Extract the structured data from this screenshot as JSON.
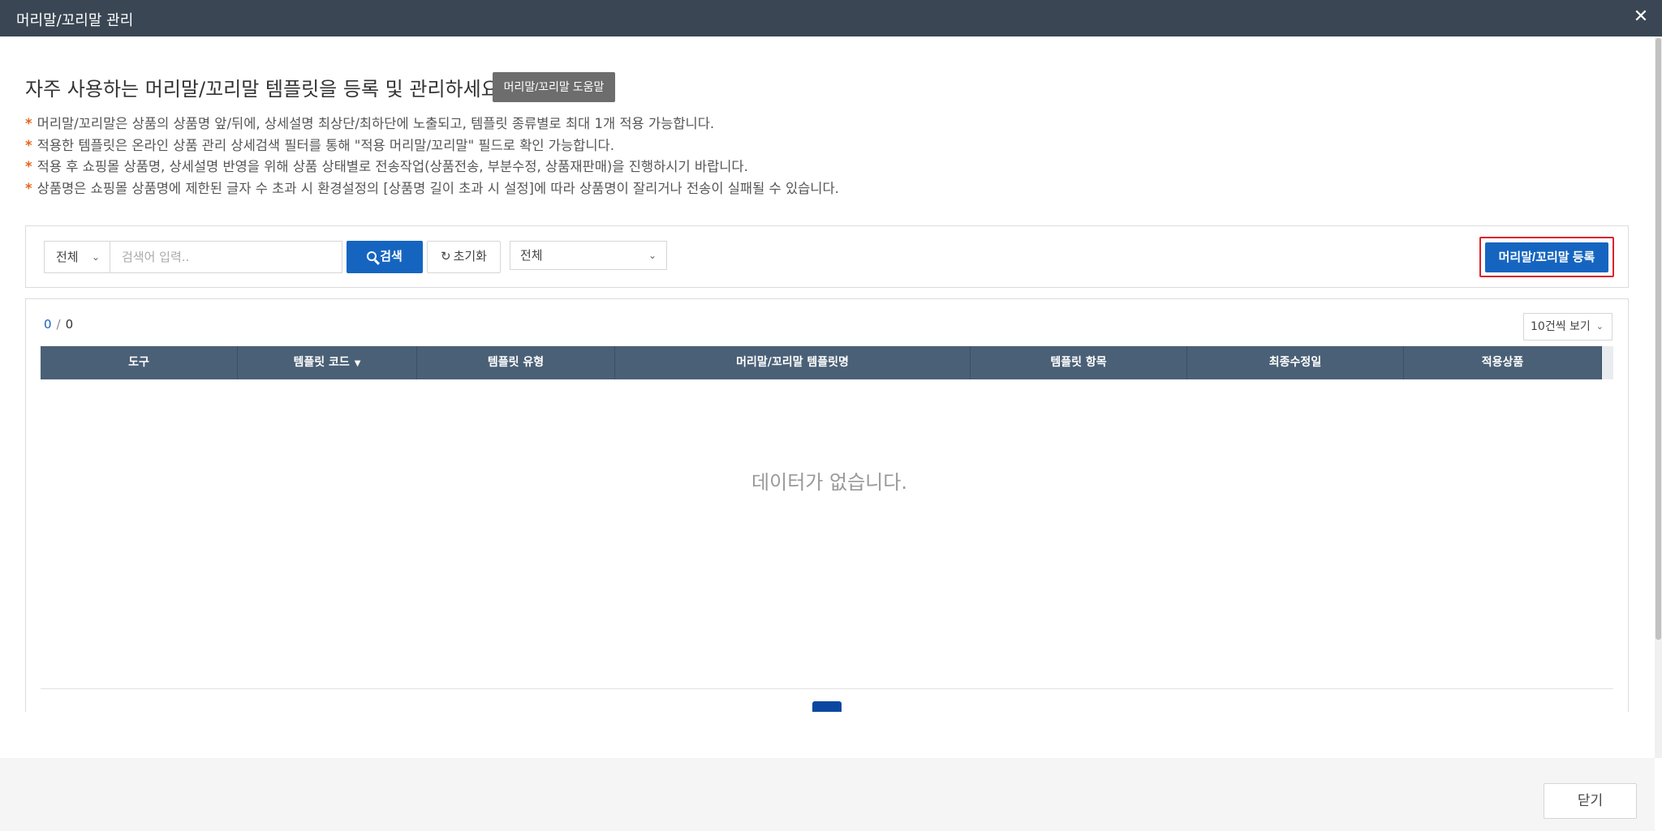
{
  "window": {
    "title": "머리말/꼬리말 관리",
    "close_icon": "close-icon"
  },
  "header": {
    "headline": "자주 사용하는 머리말/꼬리말 템플릿을 등록 및 관리하세요.",
    "help_label": "머리말/꼬리말 도움말"
  },
  "notices": [
    "머리말/꼬리말은 상품의 상품명 앞/뒤에, 상세설명 최상단/최하단에 노출되고, 템플릿 종류별로 최대 1개 적용 가능합니다.",
    "적용한 템플릿은 온라인 상품 관리 상세검색 필터를 통해 \"적용 머리말/꼬리말\" 필드로 확인 가능합니다.",
    "적용 후 쇼핑몰 상품명, 상세설명 반영을 위해 상품 상태별로 전송작업(상품전송, 부분수정, 상품재판매)을 진행하시기 바랍니다.",
    "상품명은 쇼핑몰 상품명에 제한된 글자 수 초과 시 환경설정의 [상품명 길이 초과 시 설정]에 따라 상품명이 잘리거나 전송이 실패될 수 있습니다."
  ],
  "notice_marker": "*",
  "search": {
    "type_select": "전체",
    "placeholder": "검색어 입력..",
    "value": "",
    "search_label": "검색",
    "reset_label": "초기화",
    "filter_select": "전체",
    "register_label": "머리말/꼬리말 등록"
  },
  "grid": {
    "count_current": "0",
    "count_separator": "/",
    "count_total": "0",
    "page_size": "10건씩 보기",
    "columns": [
      "도구",
      "템플릿 코드",
      "템플릿 유형",
      "머리말/꼬리말 템플릿명",
      "템플릿 항목",
      "최종수정일",
      "적용상품"
    ],
    "empty_message": "데이터가 없습니다."
  },
  "footer": {
    "close_label": "닫기"
  },
  "colors": {
    "titlebar": "#3a4653",
    "primary": "#1565c0",
    "table_header": "#4a6076",
    "notice_star": "#e8651d",
    "highlight_border": "#d9232d"
  }
}
